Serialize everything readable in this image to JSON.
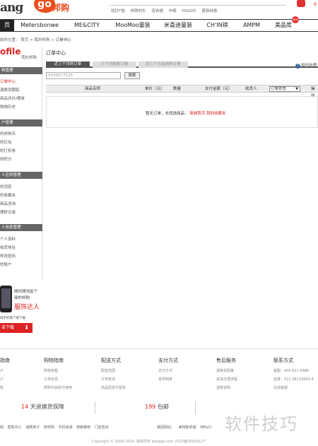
{
  "header": {
    "logo_text": "ang",
    "logo_blob": "go",
    "logo_cn": "邦购",
    "hot_links": [
      "班铃T恤",
      "邦购村衫",
      "连衣裙",
      "中裤",
      "POLO衫",
      "夏新纬卷"
    ],
    "cart_count": "0"
  },
  "nav": {
    "items": [
      "页",
      "Metersbonwe",
      "ME&CITY",
      "MooMoo童装",
      "米喜迪童装",
      "CH'IN祺",
      "AMPM",
      "美品库"
    ],
    "new_badge": "NEW"
  },
  "breadcrumb": {
    "prefix": "前的位置：",
    "home": "首页",
    "mine": "我的邦购",
    "current": "订单中心"
  },
  "sidebar": {
    "profile_title": "ofile",
    "profile_sub": "我的邦购",
    "sections": [
      {
        "title": "购管理",
        "items": [
          "订单中心",
          "退换货跟踪",
          "商品评价/晒单",
          "购物历史"
        ]
      },
      {
        "title": "户管理",
        "items": [
          "的邦购币",
          "的红包",
          "的打折券",
          "的积分"
        ]
      },
      {
        "title": "人应用管理",
        "items": [
          "的消息",
          "的收藏夹",
          "商品咨询",
          "理财记录"
        ]
      },
      {
        "title": "人信息管理",
        "items": [
          "个人资料",
          "收货地址",
          "修改密码",
          "的账户"
        ]
      }
    ]
  },
  "app_promo": {
    "line1": "随时随地逛个",
    "line2": "够的邦购",
    "line3": "服饰达人",
    "line4": "城手机客户端下载",
    "download": "击下载"
  },
  "main": {
    "title": "订单中心",
    "tabs": [
      "近三个月的订单",
      "三个月前的订单",
      "近三个月关闭的订单"
    ],
    "help": "如何办理",
    "order_placeholder": "V030077525",
    "search_btn": "搜索",
    "columns": [
      "商品名称",
      "单价（元）",
      "数量",
      "支付金额（元）",
      "收货人",
      "订单状态",
      "操作"
    ],
    "status_selected": "订单状态",
    "empty_msg": "暂无订单，去找选商品：",
    "empty_link1": "商城首页",
    "empty_link2": "我的收藏夹"
  },
  "footer": {
    "columns": [
      {
        "title": "指南",
        "links": [
          "户",
          "户",
          "收"
        ]
      },
      {
        "title": "购物指南",
        "links": [
          "购物流程",
          "订单状态",
          "邦购币获取与使用"
        ]
      },
      {
        "title": "配送方式",
        "links": [
          "配送范围",
          "订单查询",
          "商品验货与签收"
        ]
      },
      {
        "title": "支付方式",
        "links": [
          "支付方式",
          "发票制度"
        ]
      },
      {
        "title": "售后服务",
        "links": [
          "退换货政策",
          "退货办理流程",
          "退款说明"
        ]
      },
      {
        "title": "联系方式",
        "links": [
          "客服：400 821 9988",
          "监督：021-38119999-4",
          "在线客服"
        ]
      }
    ],
    "promo_days": "14",
    "promo_days_text": "天退换货保障",
    "promo_free": "199",
    "promo_free_text": "包邮",
    "bottom_links": [
      "助",
      "帮助中心",
      "诚聘英才",
      "搜邦网",
      "手机商城",
      "搜索推荐",
      "门店查询"
    ],
    "partner_label": "暴固网站：",
    "partners": [
      "美特斯邦威",
      "ME&CI"
    ],
    "copyright": "Copyright © 2009-2014, 版权所有 banggo.com 沪ICP备05033127",
    "watermark": "软件技巧"
  }
}
